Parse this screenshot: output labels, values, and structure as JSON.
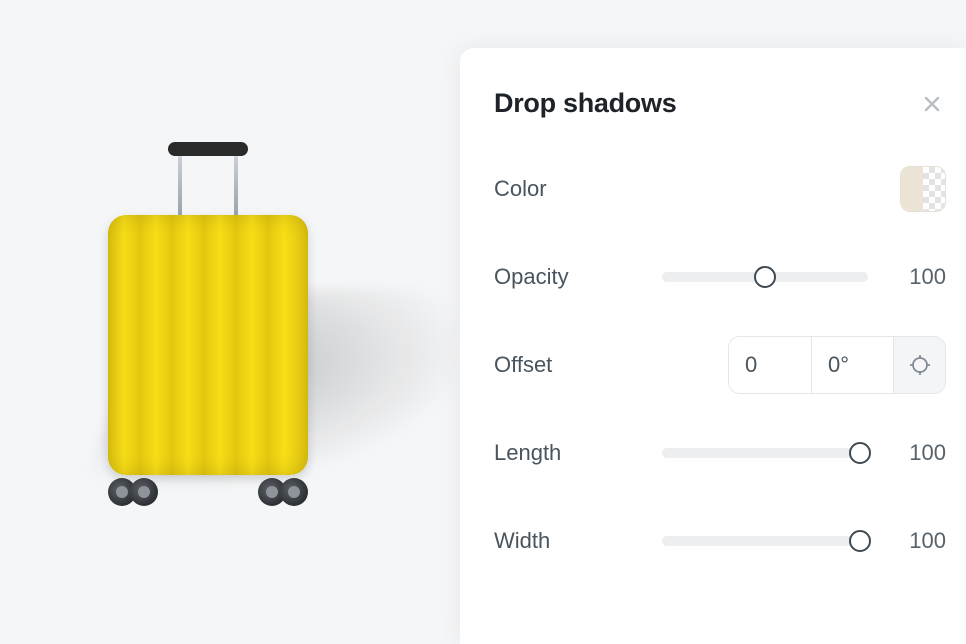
{
  "preview": {
    "object": "yellow-suitcase"
  },
  "panel": {
    "title": "Drop shadows",
    "close_icon": "close",
    "color": {
      "label": "Color",
      "swatch_hex": "#ece4d4",
      "has_alpha": true
    },
    "opacity": {
      "label": "Opacity",
      "value": "100",
      "slider_percent": 50
    },
    "offset": {
      "label": "Offset",
      "distance": "0",
      "angle": "0°",
      "target_icon": "crosshair"
    },
    "length": {
      "label": "Length",
      "value": "100",
      "slider_percent": 96
    },
    "width": {
      "label": "Width",
      "value": "100",
      "slider_percent": 96
    }
  }
}
